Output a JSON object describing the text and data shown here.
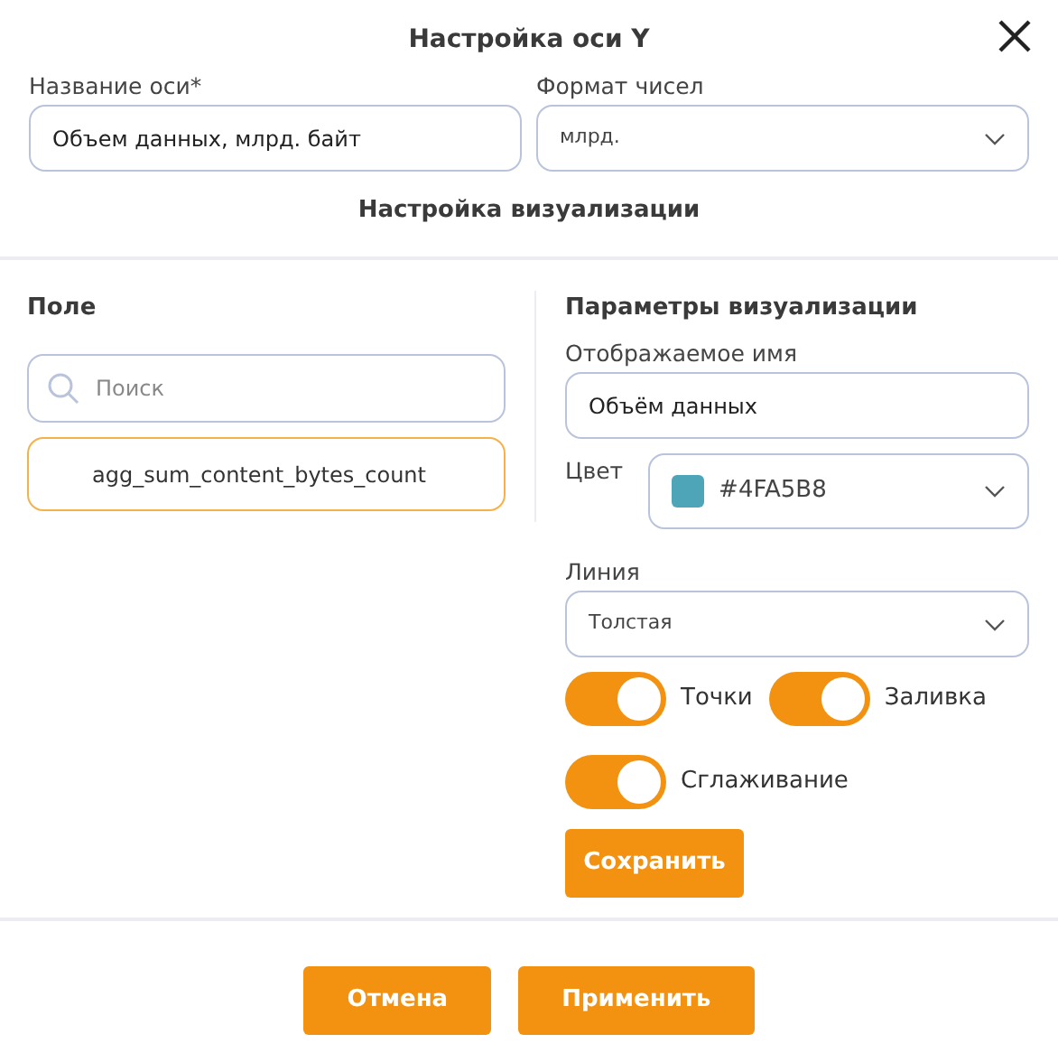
{
  "dialog": {
    "title": "Настройка оси Y"
  },
  "axis_name": {
    "label": "Название оси*",
    "value": "Объем данных, млрд. байт"
  },
  "number_format": {
    "label": "Формат чисел",
    "value": "млрд."
  },
  "section_title": "Настройка визуализации",
  "fields_panel": {
    "title": "Поле",
    "search": {
      "placeholder": "Поиск"
    },
    "items": [
      {
        "label": "agg_sum_content_bytes_count",
        "selected": true
      }
    ]
  },
  "params_panel": {
    "title": "Параметры визуализации",
    "display_name": {
      "label": "Отображаемое имя",
      "value": "Объём данных"
    },
    "color": {
      "label": "Цвет",
      "value": "#4FA5B8",
      "color": "#4fa5b8"
    },
    "line": {
      "label": "Линия",
      "value": "Толстая"
    },
    "toggles": [
      {
        "label": "Точки",
        "on": true
      },
      {
        "label": "Заливка",
        "on": true
      },
      {
        "label": "Сглаживание",
        "on": true
      }
    ],
    "save_button": "Сохранить"
  },
  "buttons": [
    {
      "label": "Отмена"
    },
    {
      "label": "Применить"
    }
  ]
}
